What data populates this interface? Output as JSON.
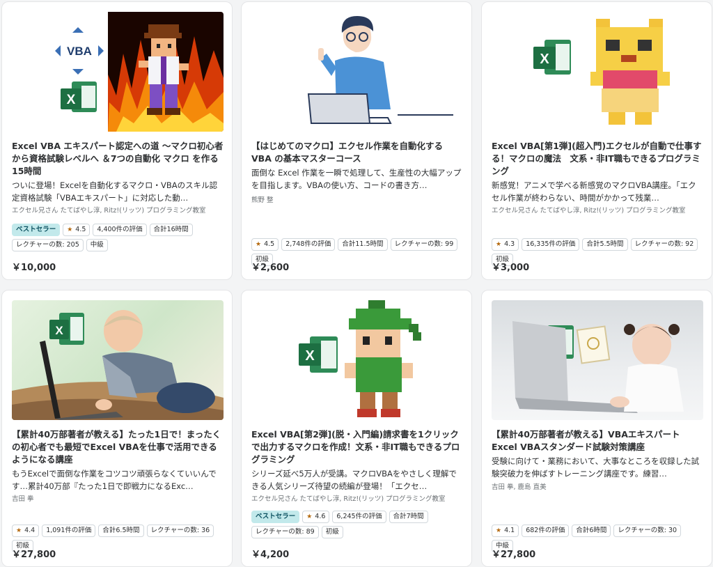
{
  "courses": [
    {
      "title": "Excel VBA エキスパート認定への道 〜マクロ初心者から資格試験レベルへ ＆7つの自動化 マクロ を作る15時間",
      "description": "ついに登場！Excelを自動化するマクロ・VBAのスキル認定資格試験「VBAエキスパート」に対応した動…",
      "instructors": "エクセル兄さん たてばやし淳, Ritz!(リッツ) プログラミング教室",
      "best_seller": "ベストセラー",
      "rating": "4.5",
      "reviews": "4,400件の評価",
      "total_hours": "合計16時間",
      "lectures": "レクチャーの数: 205",
      "level": "中級",
      "price": "￥10,000",
      "thumb_label": "VBA"
    },
    {
      "title": "【はじめてのマクロ】エクセル作業を自動化する VBA の基本マスターコース",
      "description": "面倒な Excel 作業を一瞬で処理して、生産性の大幅アップを目指します。VBAの使い方、コードの書き方…",
      "instructors": "熊野 整",
      "rating": "4.5",
      "reviews": "2,748件の評価",
      "total_hours": "合計11.5時間",
      "lectures": "レクチャーの数: 99",
      "level": "初級",
      "price": "￥2,600"
    },
    {
      "title": "Excel VBA[第1弾](超入門)エクセルが自動で仕事する！マクロの魔法　文系・非IT職もできるプログラミング",
      "description": "新感覚！アニメで学べる新感覚のマクロVBA講座。「エクセル作業が終わらない、時間がかかって残業…",
      "instructors": "エクセル兄さん たてばやし淳, Ritz!(リッツ) プログラミング教室",
      "rating": "4.3",
      "reviews": "16,335件の評価",
      "total_hours": "合計5.5時間",
      "lectures": "レクチャーの数: 92",
      "level": "初級",
      "price": "￥3,000"
    },
    {
      "title": "【累計40万部著者が教える】たった1日で！まったくの初心者でも最短でExcel VBAを仕事で活用できるようになる講座",
      "description": "もうExcelで面倒な作業をコツコツ頑張らなくていいんです…累計40万部『たった1日で即戦力になるExc…",
      "instructors": "吉田 拳",
      "rating": "4.4",
      "reviews": "1,091件の評価",
      "total_hours": "合計6.5時間",
      "lectures": "レクチャーの数: 36",
      "level": "初級",
      "price": "￥27,800"
    },
    {
      "title": "Excel VBA[第2弾](脱・入門編)請求書を1クリックで出力するマクロを作成！文系・非IT職もできるプログラミング",
      "description": "シリーズ延べ5万人が受講。マクロVBAをやさしく理解できる人気シリーズ待望の続編が登場！「エクセ…",
      "instructors": "エクセル兄さん たてばやし淳, Ritz!(リッツ) プログラミング教室",
      "best_seller": "ベストセラー",
      "rating": "4.6",
      "reviews": "6,245件の評価",
      "total_hours": "合計7時間",
      "lectures": "レクチャーの数: 89",
      "level": "初級",
      "price": "￥4,200"
    },
    {
      "title": "【累計40万部著者が教える】VBAエキスパート Excel VBAスタンダード試験対策講座",
      "description": "受験に向けて・業務において、大事なところを収録した試験突破力を伸ばすトレーニング講座です。練習…",
      "instructors": "吉田 拳, 鹿島 直美",
      "rating": "4.1",
      "reviews": "682件の評価",
      "total_hours": "合計6時間",
      "lectures": "レクチャーの数: 30",
      "level": "中級",
      "price": "￥27,800"
    }
  ],
  "icons": {
    "rating": "star-icon",
    "excel": "excel-logo-icon"
  },
  "colors": {
    "best_seller_bg": "#c2e9eb",
    "best_seller_text": "#0d5261",
    "star": "#b4690e",
    "excel_green": "#1d6f42"
  }
}
